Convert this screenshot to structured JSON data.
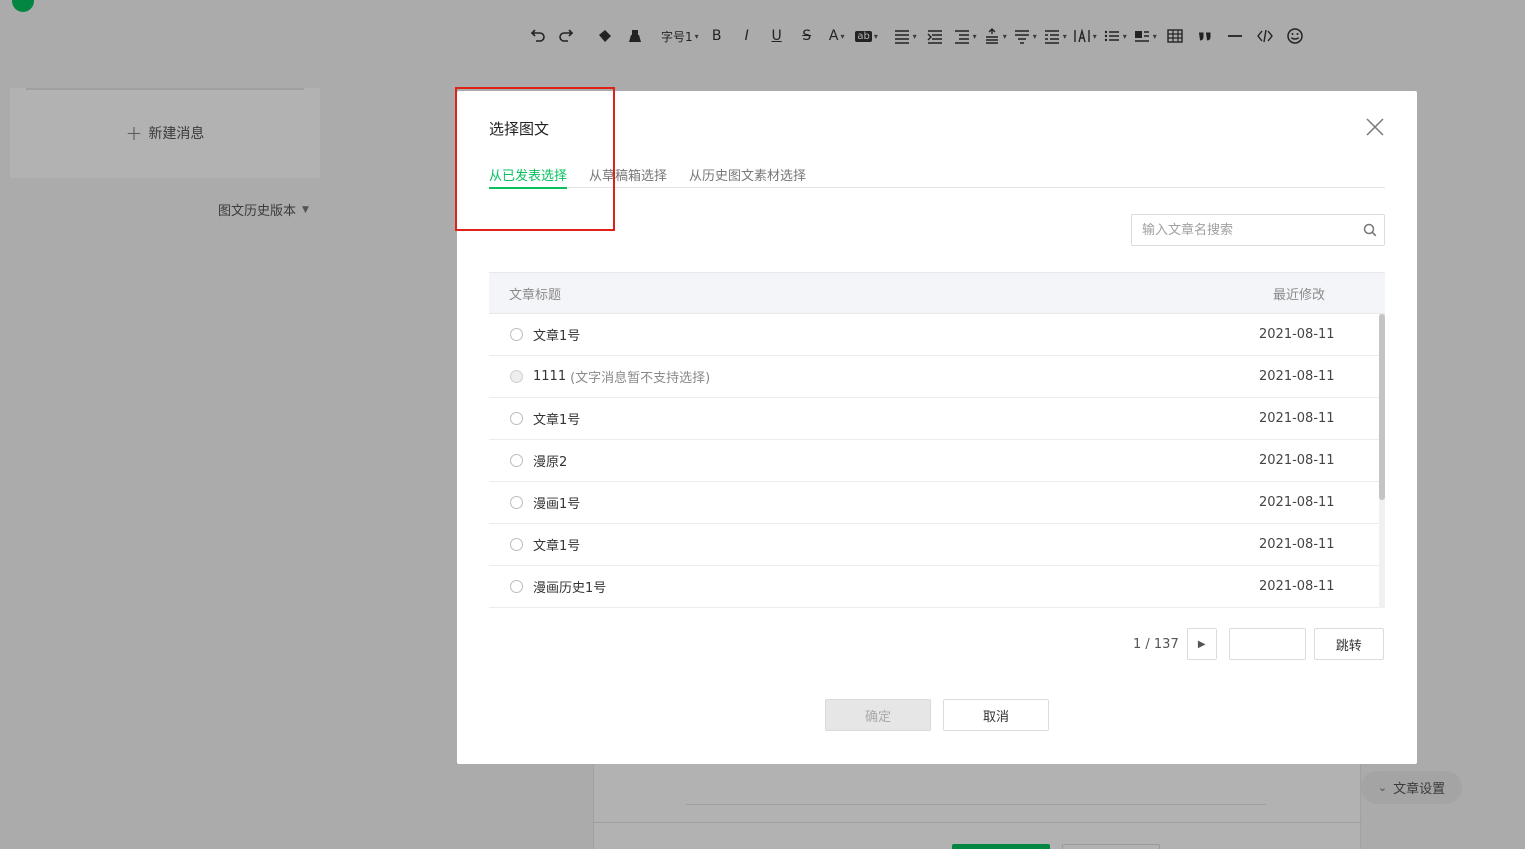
{
  "toolbar": {
    "font_size_label": "字号1",
    "items": [
      "undo-icon",
      "redo-icon",
      "format-painter-icon",
      "clear-format-icon",
      "font-size",
      "bold-icon",
      "italic-icon",
      "underline-icon",
      "strikethrough-icon",
      "font-color-icon",
      "highlight-icon",
      "align-icon",
      "indent-icon",
      "outdent-icon",
      "line-height-icon",
      "paragraph-spacing-icon",
      "list-indent-icon",
      "letter-spacing-icon",
      "bullet-list-icon",
      "float-icon",
      "table-icon",
      "quote-icon",
      "divider-icon",
      "code-icon",
      "emoji-icon"
    ],
    "bold": "B",
    "italic": "I",
    "underline": "U",
    "strike": "S",
    "font_color": "A",
    "highlight": "ab"
  },
  "left_panel": {
    "new_message": "新建消息",
    "history_version": "图文历史版本"
  },
  "article_settings": "文章设置",
  "dialog": {
    "title": "选择图文",
    "tabs": [
      {
        "label": "从已发表选择",
        "active": true
      },
      {
        "label": "从草稿箱选择",
        "active": false
      },
      {
        "label": "从历史图文素材选择",
        "active": false
      }
    ],
    "search_placeholder": "输入文章名搜索",
    "columns": {
      "title": "文章标题",
      "modified": "最近修改"
    },
    "rows": [
      {
        "title": "文章1号",
        "note": "",
        "date": "2021-08-11",
        "disabled": false
      },
      {
        "title": "1111",
        "note": "(文字消息暂不支持选择)",
        "date": "2021-08-11",
        "disabled": true
      },
      {
        "title": "文章1号",
        "note": "",
        "date": "2021-08-11",
        "disabled": false
      },
      {
        "title": "漫原2",
        "note": "",
        "date": "2021-08-11",
        "disabled": false
      },
      {
        "title": "漫画1号",
        "note": "",
        "date": "2021-08-11",
        "disabled": false
      },
      {
        "title": "文章1号",
        "note": "",
        "date": "2021-08-11",
        "disabled": false
      },
      {
        "title": "漫画历史1号",
        "note": "",
        "date": "2021-08-11",
        "disabled": false
      }
    ],
    "pagination": {
      "info": "1 / 137",
      "jump_label": "跳转"
    },
    "buttons": {
      "ok": "确定",
      "cancel": "取消"
    }
  },
  "colors": {
    "accent": "#07c160",
    "highlight_box": "#e0211a"
  }
}
